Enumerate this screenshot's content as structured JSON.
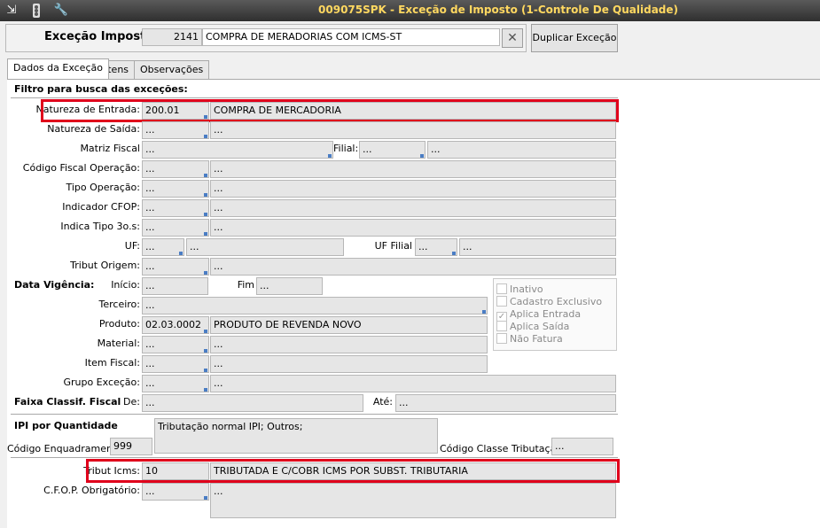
{
  "window": {
    "title": "009075SPK - Exceção de Imposto (1-Controle De Qualidade)",
    "toolbar_icons": [
      "export-icon",
      "traffic-light-icon",
      "wrench-icon"
    ]
  },
  "header": {
    "label": "Exceção Imposto",
    "code": "2141",
    "description": "COMPRA DE MERADORIAS COM ICMS-ST",
    "clear_glyph": "✕",
    "duplicate_button": "Duplicar Exceção"
  },
  "tabs": [
    {
      "label": "Dados da Exceção",
      "active": true
    },
    {
      "label": "Itens",
      "active": false
    },
    {
      "label": "Observações",
      "active": false
    }
  ],
  "filter": {
    "section_title": "Filtro para busca das exceções:",
    "natureza_entrada": {
      "label": "Natureza de Entrada:",
      "code": "200.01",
      "desc": "COMPRA DE MERCADORIA"
    },
    "natureza_saida": {
      "label": "Natureza de Saída:",
      "code": "...",
      "desc": "..."
    },
    "matriz_fiscal": {
      "label": "Matriz Fiscal",
      "value": "..."
    },
    "filial": {
      "label": "Filial:",
      "code": "...",
      "desc": "..."
    },
    "codigo_fiscal_operacao": {
      "label": "Código Fiscal Operação:",
      "code": "...",
      "desc": "..."
    },
    "tipo_operacao": {
      "label": "Tipo Operação:",
      "code": "...",
      "desc": "..."
    },
    "indicador_cfop": {
      "label": "Indicador CFOP:",
      "code": "...",
      "desc": "..."
    },
    "indica_tipo_3os": {
      "label": "Indica Tipo 3o.s:",
      "code": "...",
      "desc": "..."
    },
    "uf": {
      "label": "UF:",
      "code": "...",
      "desc": "..."
    },
    "uf_filial": {
      "label": "UF Filial",
      "code": "...",
      "desc": "..."
    },
    "tribut_origem": {
      "label": "Tribut Origem:",
      "code": "...",
      "desc": "..."
    }
  },
  "vigencia": {
    "title": "Data Vigência:",
    "inicio_label": "Início:",
    "inicio_value": "...",
    "fim_label": "Fim",
    "fim_value": "...",
    "terceiro": {
      "label": "Terceiro:",
      "value": "..."
    },
    "produto": {
      "label": "Produto:",
      "code": "02.03.0002",
      "desc": "PRODUTO DE REVENDA NOVO"
    },
    "material": {
      "label": "Material:",
      "code": "...",
      "desc": "..."
    },
    "item_fiscal": {
      "label": "Item Fiscal:",
      "code": "...",
      "desc": "..."
    },
    "grupo_excecao": {
      "label": "Grupo Exceção:",
      "code": "...",
      "desc": "..."
    }
  },
  "flags": [
    {
      "label": "Inativo",
      "checked": false
    },
    {
      "label": "Cadastro Exclusivo",
      "checked": false
    },
    {
      "label": "Aplica Entrada",
      "checked": true
    },
    {
      "label": "Aplica Saída",
      "checked": false
    },
    {
      "label": "Não Fatura",
      "checked": false
    }
  ],
  "faixa": {
    "title": "Faixa Classif. Fiscal",
    "de_label": "De:",
    "de_value": "...",
    "ate_label": "Até:",
    "ate_value": "..."
  },
  "ipi": {
    "title": "IPI por Quantidade",
    "enquadramento_label": "Código Enquadramento",
    "enquadramento_value": "999",
    "enquadramento_desc": "Tributação normal IPI; Outros;",
    "classe_label": "Código Classe Tributação",
    "classe_value": "..."
  },
  "icms": {
    "tribut_label": "Tribut Icms:",
    "tribut_code": "10",
    "tribut_desc": "TRIBUTADA E C/COBR ICMS POR SUBST. TRIBUTARIA",
    "cfop_label": "C.F.O.P. Obrigatório:",
    "cfop_code": "...",
    "cfop_desc": "..."
  }
}
